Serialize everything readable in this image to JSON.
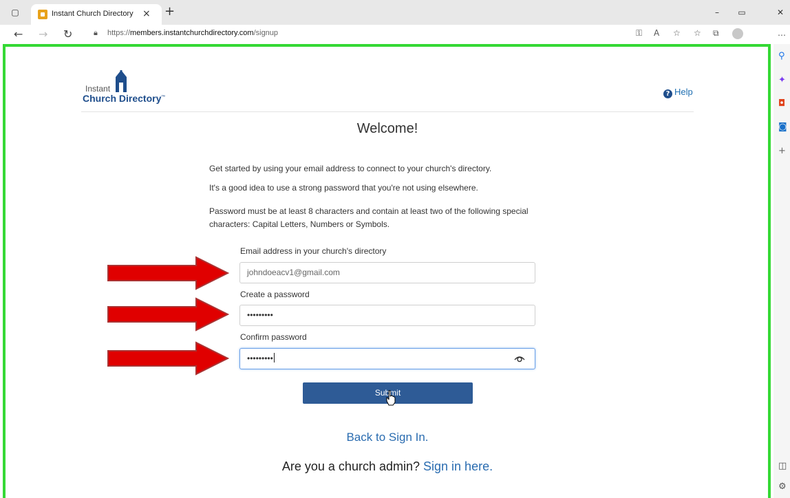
{
  "browser": {
    "tab_title": "Instant Church Directory",
    "tab_close": "×",
    "new_tab": "+",
    "url_proto": "https://",
    "url_host": "members.instantchurchdirectory.com",
    "url_path": "/signup"
  },
  "header": {
    "logo_instant": "Instant",
    "logo_church": "Church Directory",
    "logo_tm": "™",
    "help_label": "Help",
    "help_icon_glyph": "?"
  },
  "main": {
    "title": "Welcome!",
    "intro": "Get started by using your email address to connect to your church's directory.",
    "password_tip": "It's a good idea to use a strong password that you're not using elsewhere.",
    "password_rules": "Password must be at least 8 characters and contain at least two of the following special characters: Capital Letters, Numbers or Symbols."
  },
  "form": {
    "email_label": "Email address in your church's directory",
    "email_value": "johndoeacv1@gmail.com",
    "password_label": "Create a password",
    "password_value": "•••••••••",
    "confirm_label": "Confirm password",
    "confirm_value": "•••••••••",
    "submit_label": "Submit"
  },
  "footer": {
    "back_link": "Back to Sign In.",
    "admin_prefix": "Are you a church admin?",
    "admin_link": "Sign in here."
  },
  "colors": {
    "accent": "#2e5b96",
    "link": "#2a6cb0",
    "highlight_border": "#35d935",
    "arrow": "#e00000"
  }
}
